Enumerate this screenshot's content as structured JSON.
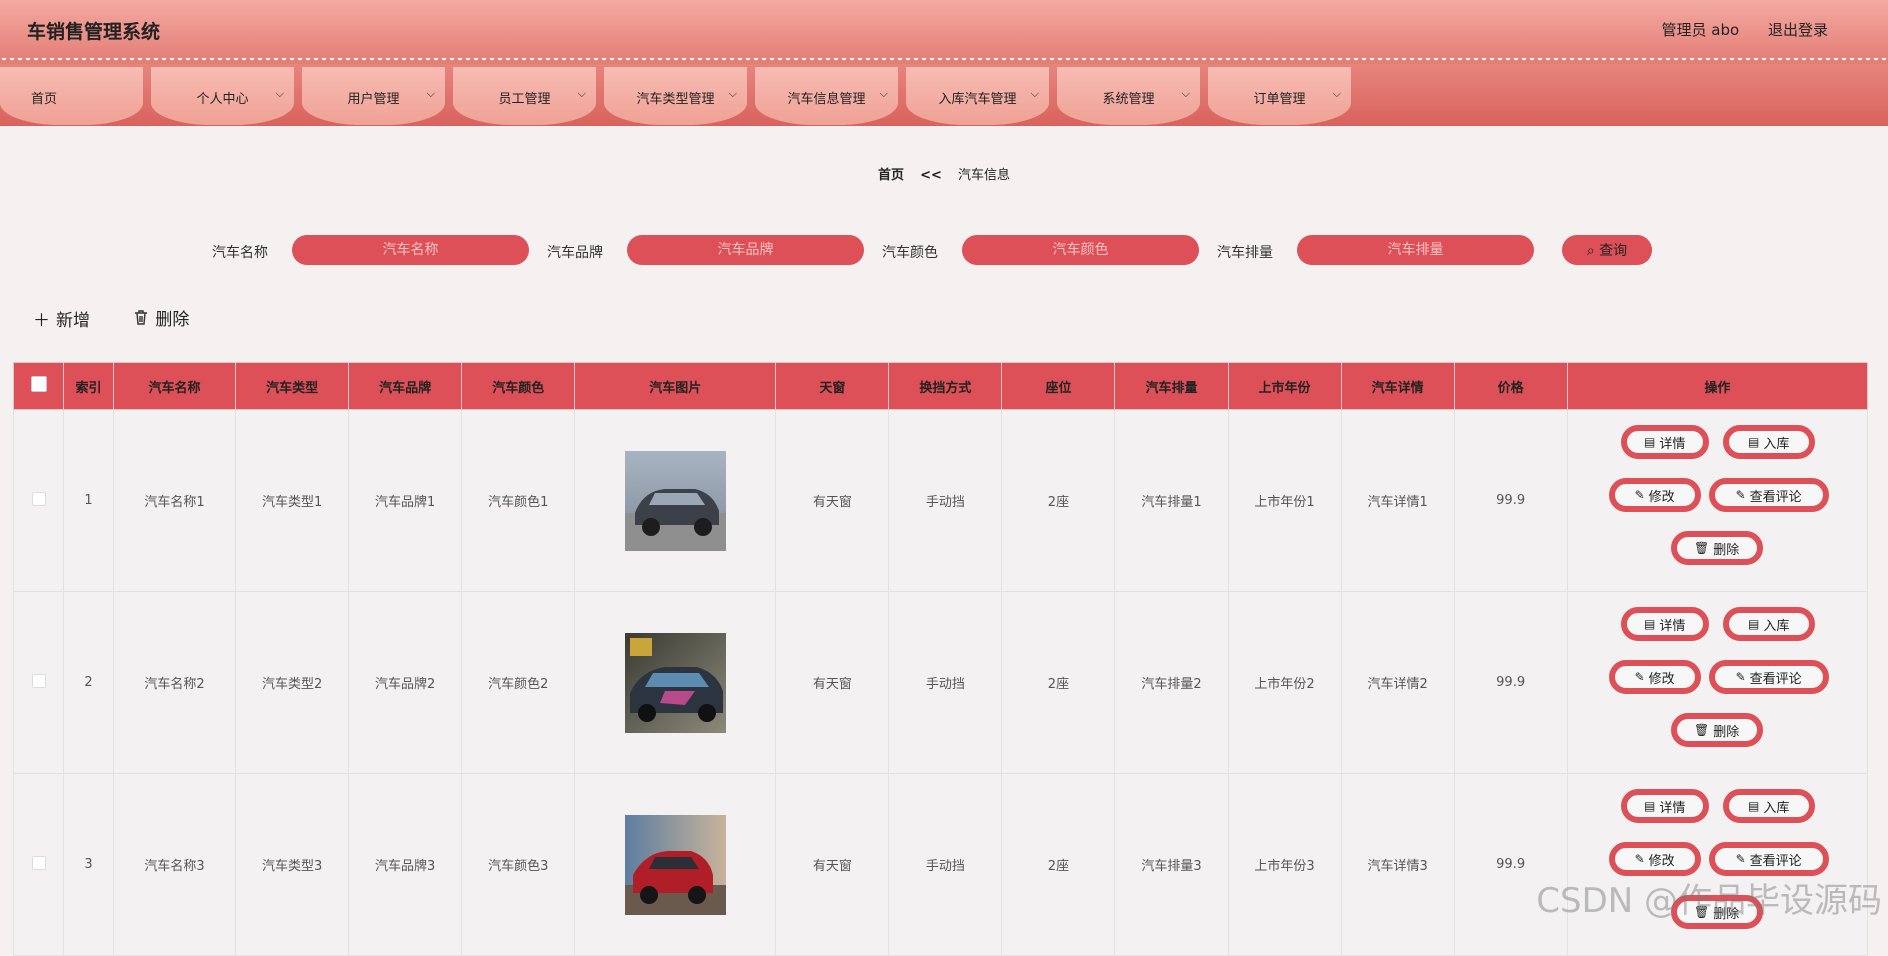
{
  "header": {
    "title": "车销售管理系统",
    "user": "管理员 abo",
    "logout": "退出登录"
  },
  "nav": [
    {
      "label": "首页",
      "chevron": false
    },
    {
      "label": "个人中心",
      "chevron": true
    },
    {
      "label": "用户管理",
      "chevron": true
    },
    {
      "label": "员工管理",
      "chevron": true
    },
    {
      "label": "汽车类型管理",
      "chevron": true
    },
    {
      "label": "汽车信息管理",
      "chevron": true
    },
    {
      "label": "入库汽车管理",
      "chevron": true
    },
    {
      "label": "系统管理",
      "chevron": true
    },
    {
      "label": "订单管理",
      "chevron": true
    }
  ],
  "breadcrumb": {
    "home": "首页",
    "sep": "<<",
    "current": "汽车信息"
  },
  "search": {
    "name_label": "汽车名称",
    "name_placeholder": "汽车名称",
    "brand_label": "汽车品牌",
    "brand_placeholder": "汽车品牌",
    "color_label": "汽车颜色",
    "color_placeholder": "汽车颜色",
    "displacement_label": "汽车排量",
    "displacement_placeholder": "汽车排量",
    "button": "查询"
  },
  "actions": {
    "add": "新增",
    "delete": "删除"
  },
  "table": {
    "headers": [
      "索引",
      "汽车名称",
      "汽车类型",
      "汽车品牌",
      "汽车颜色",
      "汽车图片",
      "天窗",
      "换挡方式",
      "座位",
      "汽车排量",
      "上市年份",
      "汽车详情",
      "价格",
      "操作"
    ],
    "rows": [
      {
        "index": "1",
        "name": "汽车名称1",
        "type": "汽车类型1",
        "brand": "汽车品牌1",
        "color": "汽车颜色1",
        "sunroof": "有天窗",
        "gear": "手动挡",
        "seats": "2座",
        "displacement": "汽车排量1",
        "year": "上市年份1",
        "detail": "汽车详情1",
        "price": "99.9"
      },
      {
        "index": "2",
        "name": "汽车名称2",
        "type": "汽车类型2",
        "brand": "汽车品牌2",
        "color": "汽车颜色2",
        "sunroof": "有天窗",
        "gear": "手动挡",
        "seats": "2座",
        "displacement": "汽车排量2",
        "year": "上市年份2",
        "detail": "汽车详情2",
        "price": "99.9"
      },
      {
        "index": "3",
        "name": "汽车名称3",
        "type": "汽车类型3",
        "brand": "汽车品牌3",
        "color": "汽车颜色3",
        "sunroof": "有天窗",
        "gear": "手动挡",
        "seats": "2座",
        "displacement": "汽车排量3",
        "year": "上市年份3",
        "detail": "汽车详情3",
        "price": "99.9"
      }
    ],
    "ops": {
      "detail": "详情",
      "stock": "入库",
      "edit": "修改",
      "review": "查看评论",
      "delete": "删除"
    }
  },
  "watermark": "CSDN @作品毕设源码",
  "colors": {
    "accent": "#dd5057",
    "nav_tab": "#f3aca2",
    "background": "#f4f1f0"
  }
}
